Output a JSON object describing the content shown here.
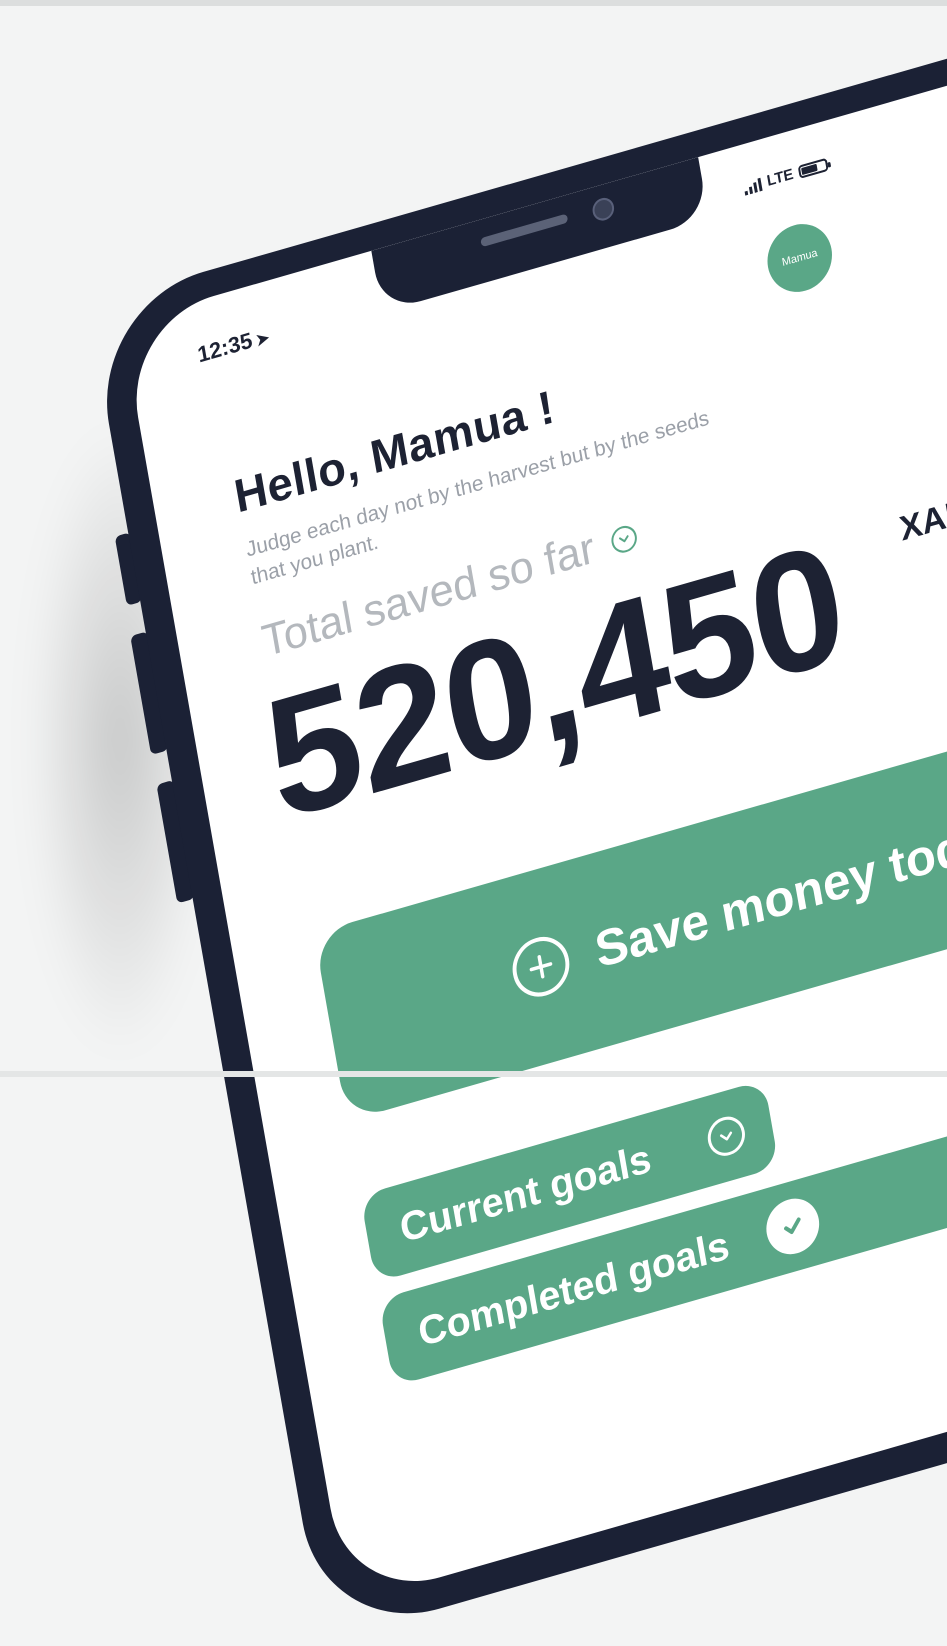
{
  "status_bar": {
    "time": "12:35",
    "network": "LTE"
  },
  "profile": {
    "avatar_initials": "Mamua"
  },
  "greeting": {
    "title": "Hello, Mamua !",
    "quote": "Judge each day not by the harvest but by the seeds that you plant."
  },
  "savings": {
    "label": "Total saved so far",
    "amount": "520,450",
    "currency": "XAF"
  },
  "actions": {
    "save_label": "Save money today"
  },
  "goals": {
    "current_label": "Current goals",
    "completed_label": "Completed goals"
  },
  "colors": {
    "accent": "#5aa787",
    "phone_frame": "#1b2135",
    "text_dark": "#1d2233",
    "text_muted": "#9ba0a8"
  }
}
